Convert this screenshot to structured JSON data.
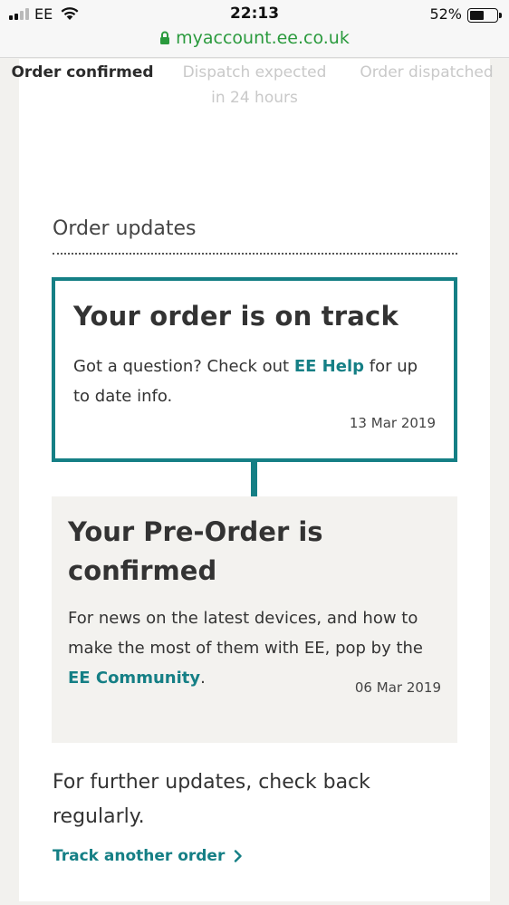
{
  "status_bar": {
    "carrier": "EE",
    "time": "22:13",
    "battery": "52%",
    "battery_level": 0.52,
    "url": "myaccount.ee.co.uk"
  },
  "progress": {
    "steps": [
      {
        "label": "Order confirmed",
        "state": "active"
      },
      {
        "label": "Dispatch expected in 24 hours",
        "state": "pending"
      },
      {
        "label": "Order dispatched",
        "state": "pending"
      }
    ]
  },
  "order_updates": {
    "title": "Order updates",
    "current": {
      "title": "Your order is on track",
      "text_before": "Got a question? Check out ",
      "link": "EE Help",
      "text_after": " for up to date info.",
      "date": "13 Mar 2019"
    },
    "previous": {
      "title": "Your Pre-Order is confirmed",
      "text_before": "For news on the latest devices, and how to make the most of them with EE, pop by the ",
      "link": "EE Community",
      "text_after": ".",
      "date": "06 Mar 2019"
    }
  },
  "further_updates": "For further updates, check back regularly.",
  "track_another": "Track another order",
  "colors": {
    "accent": "#157f85",
    "url_green": "#2a9a3d",
    "panel": "#f3f2ef"
  }
}
